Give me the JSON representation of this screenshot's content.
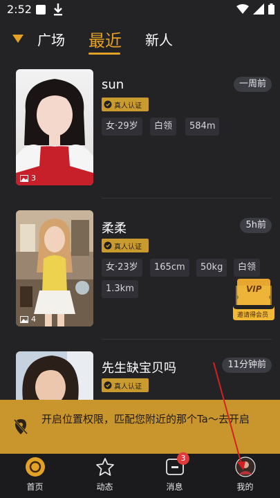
{
  "status_bar": {
    "time": "2:52"
  },
  "tabs": [
    {
      "label": "广场",
      "active": false
    },
    {
      "label": "最近",
      "active": true
    },
    {
      "label": "新人",
      "active": false
    }
  ],
  "cards": [
    {
      "name": "sun",
      "time": "一周前",
      "verified": "真人认证",
      "photo_count": "3",
      "tags": [
        "女·29岁",
        "白领",
        "584m"
      ]
    },
    {
      "name": "柔柔",
      "time": "5h前",
      "verified": "真人认证",
      "photo_count": "4",
      "tags": [
        "女·23岁",
        "165cm",
        "50kg",
        "白领",
        "1.3km"
      ]
    },
    {
      "name": "先生缺宝贝吗",
      "time": "11分钟前",
      "verified": "真人认证"
    }
  ],
  "vip": {
    "label": "VIP",
    "caption": "邀请得会员"
  },
  "banner": {
    "text": "开启位置权限，匹配您附近的那个Ta～去开启"
  },
  "nav": [
    {
      "label": "首页",
      "icon": "home-circle-icon",
      "active": true
    },
    {
      "label": "动态",
      "icon": "star-icon",
      "active": false
    },
    {
      "label": "消息",
      "icon": "message-icon",
      "active": false,
      "badge": "3"
    },
    {
      "label": "我的",
      "icon": "avatar-icon",
      "active": false
    }
  ],
  "colors": {
    "accent": "#e4a127",
    "background": "#232326",
    "banner": "#c9952d",
    "badge": "#e03a3a"
  }
}
